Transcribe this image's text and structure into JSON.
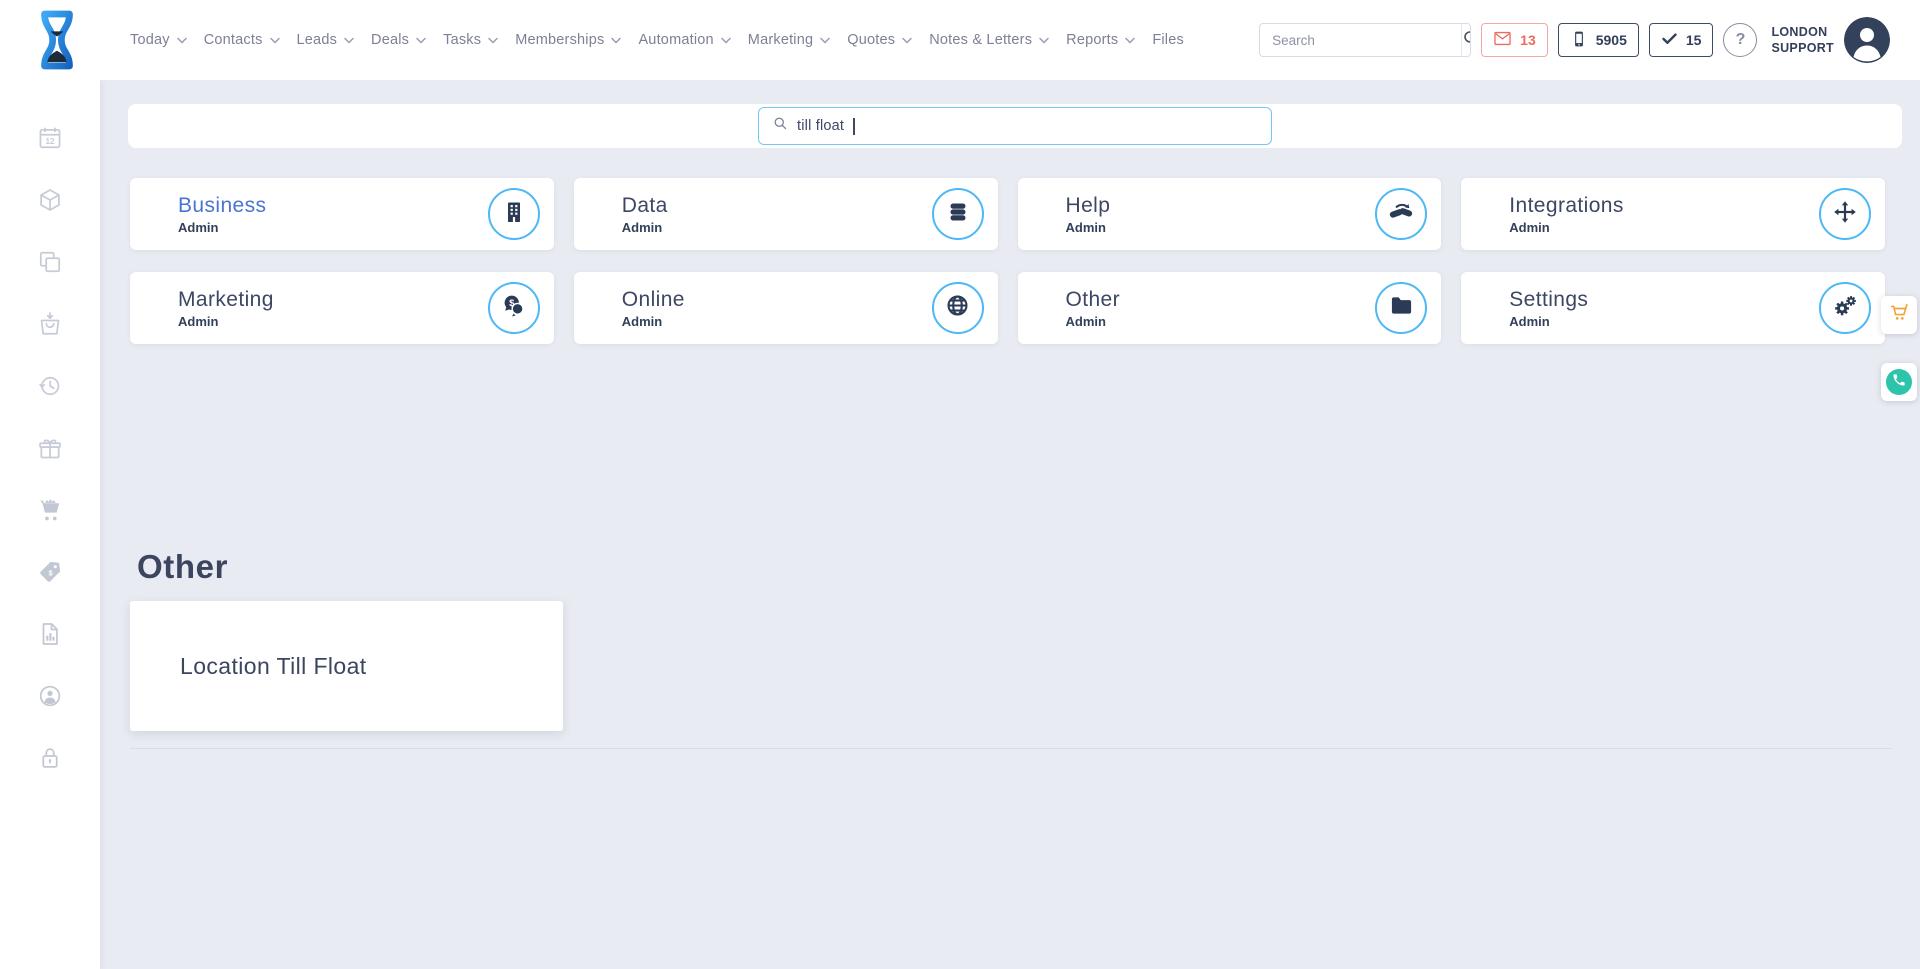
{
  "topbar": {
    "nav": [
      {
        "label": "Today",
        "has_menu": true
      },
      {
        "label": "Contacts",
        "has_menu": true
      },
      {
        "label": "Leads",
        "has_menu": true
      },
      {
        "label": "Deals",
        "has_menu": true
      },
      {
        "label": "Tasks",
        "has_menu": true
      },
      {
        "label": "Memberships",
        "has_menu": true
      },
      {
        "label": "Automation",
        "has_menu": true
      },
      {
        "label": "Marketing",
        "has_menu": true
      },
      {
        "label": "Quotes",
        "has_menu": true
      },
      {
        "label": "Notes & Letters",
        "has_menu": true
      },
      {
        "label": "Reports",
        "has_menu": true
      },
      {
        "label": "Files",
        "has_menu": false
      }
    ],
    "search_placeholder": "Search",
    "mail_count": "13",
    "call_count": "5905",
    "task_count": "15",
    "help_label": "?",
    "user_name_line1": "LONDON",
    "user_name_line2": "SUPPORT"
  },
  "sidebar": {
    "calendar_day": "12",
    "items": [
      {
        "icon": "calendar-icon"
      },
      {
        "icon": "cube-icon"
      },
      {
        "icon": "copy-icon"
      },
      {
        "icon": "bag-receive-icon"
      },
      {
        "icon": "history-icon"
      },
      {
        "icon": "gift-icon"
      },
      {
        "icon": "cart-icon"
      },
      {
        "icon": "price-tag-icon"
      },
      {
        "icon": "report-file-icon"
      },
      {
        "icon": "user-history-icon"
      },
      {
        "icon": "lock-icon"
      }
    ]
  },
  "admin_home": {
    "search_value": "till float",
    "cards": [
      {
        "title": "Business",
        "subtitle": "Admin",
        "icon": "building-icon"
      },
      {
        "title": "Data",
        "subtitle": "Admin",
        "icon": "database-icon"
      },
      {
        "title": "Help",
        "subtitle": "Admin",
        "icon": "handshake-icon"
      },
      {
        "title": "Integrations",
        "subtitle": "Admin",
        "icon": "move-arrows-icon"
      },
      {
        "title": "Marketing",
        "subtitle": "Admin",
        "icon": "chat-dollar-icon"
      },
      {
        "title": "Online",
        "subtitle": "Admin",
        "icon": "globe-icon"
      },
      {
        "title": "Other",
        "subtitle": "Admin",
        "icon": "folder-icon"
      },
      {
        "title": "Settings",
        "subtitle": "Admin",
        "icon": "gears-icon"
      }
    ],
    "results_section": {
      "heading": "Other",
      "items": [
        {
          "label": "Location Till Float"
        }
      ]
    }
  },
  "side_tabs": {
    "cart_icon": "cart-icon",
    "phone_icon": "phone-icon"
  },
  "colors": {
    "accent_light_blue": "#4cb8f5",
    "navy": "#2c3b55",
    "title_blue": "#4a74d4",
    "alert_red": "#ed6a60",
    "tab_orange": "#f2a53c",
    "tab_teal": "#2ec3ab",
    "background": "#e9ebf2"
  }
}
